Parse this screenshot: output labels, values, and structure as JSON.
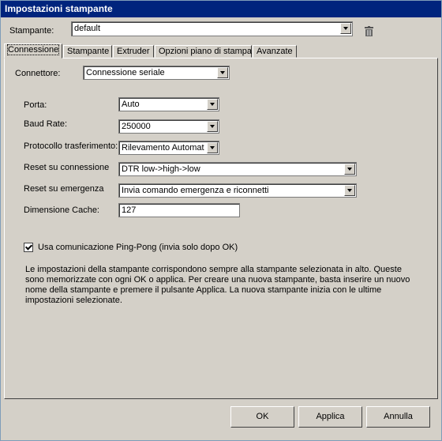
{
  "window": {
    "title": "Impostazioni stampante"
  },
  "printer": {
    "label": "Stampante:",
    "value": "default",
    "delete_icon": "trash-icon"
  },
  "tabs": [
    {
      "label": "Connessione",
      "active": true
    },
    {
      "label": "Stampante",
      "active": false
    },
    {
      "label": "Extruder",
      "active": false
    },
    {
      "label": "Opzioni piano di stampa",
      "active": false
    },
    {
      "label": "Avanzate",
      "active": false
    }
  ],
  "connection": {
    "connector_label": "Connettore:",
    "connector_value": "Connessione seriale",
    "port_label": "Porta:",
    "port_value": "Auto",
    "baud_label": "Baud Rate:",
    "baud_value": "250000",
    "protocol_label": "Protocollo trasferimento:",
    "protocol_value": "Rilevamento Automatic",
    "reset_connect_label": "Reset su connessione",
    "reset_connect_value": "DTR low->high->low",
    "reset_emergency_label": "Reset su emergenza",
    "reset_emergency_value": "Invia comando emergenza e riconnetti",
    "cache_label": "Dimensione Cache:",
    "cache_value": "127",
    "pingpong_label": "Usa comunicazione Ping-Pong (invia solo dopo OK)",
    "pingpong_checked": true,
    "info_text": "Le impostazioni della stampante corrispondono sempre alla stampante selezionata in alto. Queste sono memorizzate con ogni OK o applica. Per creare una nuova stampante, basta inserire un nuovo nome della stampante e premere il pulsante Applica. La nuova stampante inizia con le ultime impostazioni selezionate."
  },
  "buttons": {
    "ok": "OK",
    "apply": "Applica",
    "cancel": "Annulla"
  }
}
